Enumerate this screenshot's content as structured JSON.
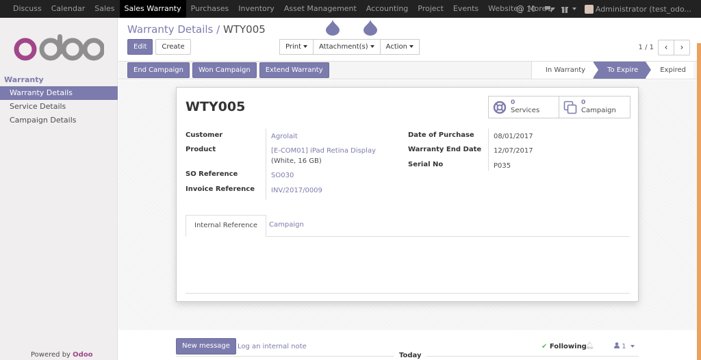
{
  "topbar": {
    "menu": [
      "Discuss",
      "Calendar",
      "Sales",
      "Sales Warranty",
      "Purchases",
      "Inventory",
      "Asset Management",
      "Accounting",
      "Project",
      "Events",
      "Website",
      "More"
    ],
    "active_index": 3,
    "notifications": "10",
    "user": "Administrator (test_odo..."
  },
  "sidebar": {
    "logo": "odoo",
    "section": "Warranty",
    "items": [
      "Warranty Details",
      "Service Details",
      "Campaign Details"
    ],
    "powered_prefix": "Powered by",
    "powered_brand": "Odoo"
  },
  "breadcrumb": {
    "parent": "Warranty Details",
    "separator": "/",
    "current": "WTY005"
  },
  "actions": {
    "edit": "Edit",
    "create": "Create",
    "print": "Print",
    "attachments": "Attachment(s)",
    "action": "Action"
  },
  "pager": {
    "value": "1 / 1",
    "prev": "‹",
    "next": "›"
  },
  "statusbar": {
    "buttons": [
      "End Campaign",
      "Won Campaign",
      "Extend Warranty"
    ],
    "stages": [
      "In Warranty",
      "To Expire",
      "Expired"
    ],
    "active_stage": "To Expire"
  },
  "record": {
    "name": "WTY005",
    "smart_buttons": [
      {
        "count": "0",
        "label": "Services",
        "icon": "lifebuoy-icon"
      },
      {
        "count": "0",
        "label": "Campaign",
        "icon": "copy-icon"
      }
    ],
    "left_fields": {
      "customer_label": "Customer",
      "customer": "Agrolait",
      "product_label": "Product",
      "product": "[E-COM01] iPad Retina Display",
      "product_variant": "(White, 16 GB)",
      "so_label": "SO Reference",
      "so": "SO030",
      "invoice_label": "Invoice Reference",
      "invoice": "INV/2017/0009"
    },
    "right_fields": {
      "date_label": "Date of Purchase",
      "date": "08/01/2017",
      "end_label": "Warranty End Date",
      "end": "12/07/2017",
      "serial_label": "Serial No",
      "serial": "P035"
    },
    "tabs": [
      "Internal Reference",
      "Campaign"
    ]
  },
  "chatter": {
    "new_message": "New message",
    "log_note": "Log an internal note",
    "following": "Following",
    "followers": "1",
    "today": "Today"
  },
  "colors": {
    "brand": "#7c7bad",
    "navbar": "#222222",
    "logo_o": "#a24689",
    "logo_doo": "#8f8f8f"
  }
}
